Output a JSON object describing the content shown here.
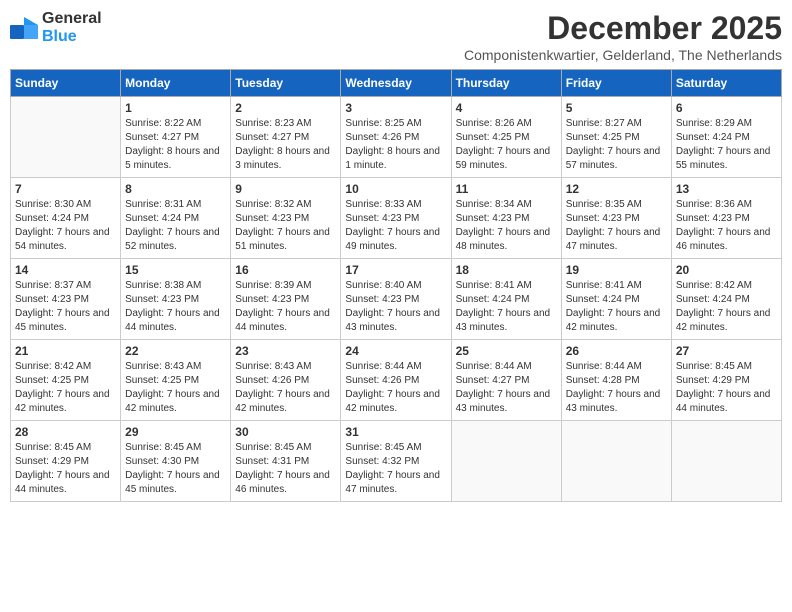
{
  "logo": {
    "general": "General",
    "blue": "Blue"
  },
  "header": {
    "month": "December 2025",
    "location": "Componistenkwartier, Gelderland, The Netherlands"
  },
  "days_of_week": [
    "Sunday",
    "Monday",
    "Tuesday",
    "Wednesday",
    "Thursday",
    "Friday",
    "Saturday"
  ],
  "weeks": [
    [
      {
        "day": "",
        "sunrise": "",
        "sunset": "",
        "daylight": ""
      },
      {
        "day": "1",
        "sunrise": "Sunrise: 8:22 AM",
        "sunset": "Sunset: 4:27 PM",
        "daylight": "Daylight: 8 hours and 5 minutes."
      },
      {
        "day": "2",
        "sunrise": "Sunrise: 8:23 AM",
        "sunset": "Sunset: 4:27 PM",
        "daylight": "Daylight: 8 hours and 3 minutes."
      },
      {
        "day": "3",
        "sunrise": "Sunrise: 8:25 AM",
        "sunset": "Sunset: 4:26 PM",
        "daylight": "Daylight: 8 hours and 1 minute."
      },
      {
        "day": "4",
        "sunrise": "Sunrise: 8:26 AM",
        "sunset": "Sunset: 4:25 PM",
        "daylight": "Daylight: 7 hours and 59 minutes."
      },
      {
        "day": "5",
        "sunrise": "Sunrise: 8:27 AM",
        "sunset": "Sunset: 4:25 PM",
        "daylight": "Daylight: 7 hours and 57 minutes."
      },
      {
        "day": "6",
        "sunrise": "Sunrise: 8:29 AM",
        "sunset": "Sunset: 4:24 PM",
        "daylight": "Daylight: 7 hours and 55 minutes."
      }
    ],
    [
      {
        "day": "7",
        "sunrise": "Sunrise: 8:30 AM",
        "sunset": "Sunset: 4:24 PM",
        "daylight": "Daylight: 7 hours and 54 minutes."
      },
      {
        "day": "8",
        "sunrise": "Sunrise: 8:31 AM",
        "sunset": "Sunset: 4:24 PM",
        "daylight": "Daylight: 7 hours and 52 minutes."
      },
      {
        "day": "9",
        "sunrise": "Sunrise: 8:32 AM",
        "sunset": "Sunset: 4:23 PM",
        "daylight": "Daylight: 7 hours and 51 minutes."
      },
      {
        "day": "10",
        "sunrise": "Sunrise: 8:33 AM",
        "sunset": "Sunset: 4:23 PM",
        "daylight": "Daylight: 7 hours and 49 minutes."
      },
      {
        "day": "11",
        "sunrise": "Sunrise: 8:34 AM",
        "sunset": "Sunset: 4:23 PM",
        "daylight": "Daylight: 7 hours and 48 minutes."
      },
      {
        "day": "12",
        "sunrise": "Sunrise: 8:35 AM",
        "sunset": "Sunset: 4:23 PM",
        "daylight": "Daylight: 7 hours and 47 minutes."
      },
      {
        "day": "13",
        "sunrise": "Sunrise: 8:36 AM",
        "sunset": "Sunset: 4:23 PM",
        "daylight": "Daylight: 7 hours and 46 minutes."
      }
    ],
    [
      {
        "day": "14",
        "sunrise": "Sunrise: 8:37 AM",
        "sunset": "Sunset: 4:23 PM",
        "daylight": "Daylight: 7 hours and 45 minutes."
      },
      {
        "day": "15",
        "sunrise": "Sunrise: 8:38 AM",
        "sunset": "Sunset: 4:23 PM",
        "daylight": "Daylight: 7 hours and 44 minutes."
      },
      {
        "day": "16",
        "sunrise": "Sunrise: 8:39 AM",
        "sunset": "Sunset: 4:23 PM",
        "daylight": "Daylight: 7 hours and 44 minutes."
      },
      {
        "day": "17",
        "sunrise": "Sunrise: 8:40 AM",
        "sunset": "Sunset: 4:23 PM",
        "daylight": "Daylight: 7 hours and 43 minutes."
      },
      {
        "day": "18",
        "sunrise": "Sunrise: 8:41 AM",
        "sunset": "Sunset: 4:24 PM",
        "daylight": "Daylight: 7 hours and 43 minutes."
      },
      {
        "day": "19",
        "sunrise": "Sunrise: 8:41 AM",
        "sunset": "Sunset: 4:24 PM",
        "daylight": "Daylight: 7 hours and 42 minutes."
      },
      {
        "day": "20",
        "sunrise": "Sunrise: 8:42 AM",
        "sunset": "Sunset: 4:24 PM",
        "daylight": "Daylight: 7 hours and 42 minutes."
      }
    ],
    [
      {
        "day": "21",
        "sunrise": "Sunrise: 8:42 AM",
        "sunset": "Sunset: 4:25 PM",
        "daylight": "Daylight: 7 hours and 42 minutes."
      },
      {
        "day": "22",
        "sunrise": "Sunrise: 8:43 AM",
        "sunset": "Sunset: 4:25 PM",
        "daylight": "Daylight: 7 hours and 42 minutes."
      },
      {
        "day": "23",
        "sunrise": "Sunrise: 8:43 AM",
        "sunset": "Sunset: 4:26 PM",
        "daylight": "Daylight: 7 hours and 42 minutes."
      },
      {
        "day": "24",
        "sunrise": "Sunrise: 8:44 AM",
        "sunset": "Sunset: 4:26 PM",
        "daylight": "Daylight: 7 hours and 42 minutes."
      },
      {
        "day": "25",
        "sunrise": "Sunrise: 8:44 AM",
        "sunset": "Sunset: 4:27 PM",
        "daylight": "Daylight: 7 hours and 43 minutes."
      },
      {
        "day": "26",
        "sunrise": "Sunrise: 8:44 AM",
        "sunset": "Sunset: 4:28 PM",
        "daylight": "Daylight: 7 hours and 43 minutes."
      },
      {
        "day": "27",
        "sunrise": "Sunrise: 8:45 AM",
        "sunset": "Sunset: 4:29 PM",
        "daylight": "Daylight: 7 hours and 44 minutes."
      }
    ],
    [
      {
        "day": "28",
        "sunrise": "Sunrise: 8:45 AM",
        "sunset": "Sunset: 4:29 PM",
        "daylight": "Daylight: 7 hours and 44 minutes."
      },
      {
        "day": "29",
        "sunrise": "Sunrise: 8:45 AM",
        "sunset": "Sunset: 4:30 PM",
        "daylight": "Daylight: 7 hours and 45 minutes."
      },
      {
        "day": "30",
        "sunrise": "Sunrise: 8:45 AM",
        "sunset": "Sunset: 4:31 PM",
        "daylight": "Daylight: 7 hours and 46 minutes."
      },
      {
        "day": "31",
        "sunrise": "Sunrise: 8:45 AM",
        "sunset": "Sunset: 4:32 PM",
        "daylight": "Daylight: 7 hours and 47 minutes."
      },
      {
        "day": "",
        "sunrise": "",
        "sunset": "",
        "daylight": ""
      },
      {
        "day": "",
        "sunrise": "",
        "sunset": "",
        "daylight": ""
      },
      {
        "day": "",
        "sunrise": "",
        "sunset": "",
        "daylight": ""
      }
    ]
  ]
}
